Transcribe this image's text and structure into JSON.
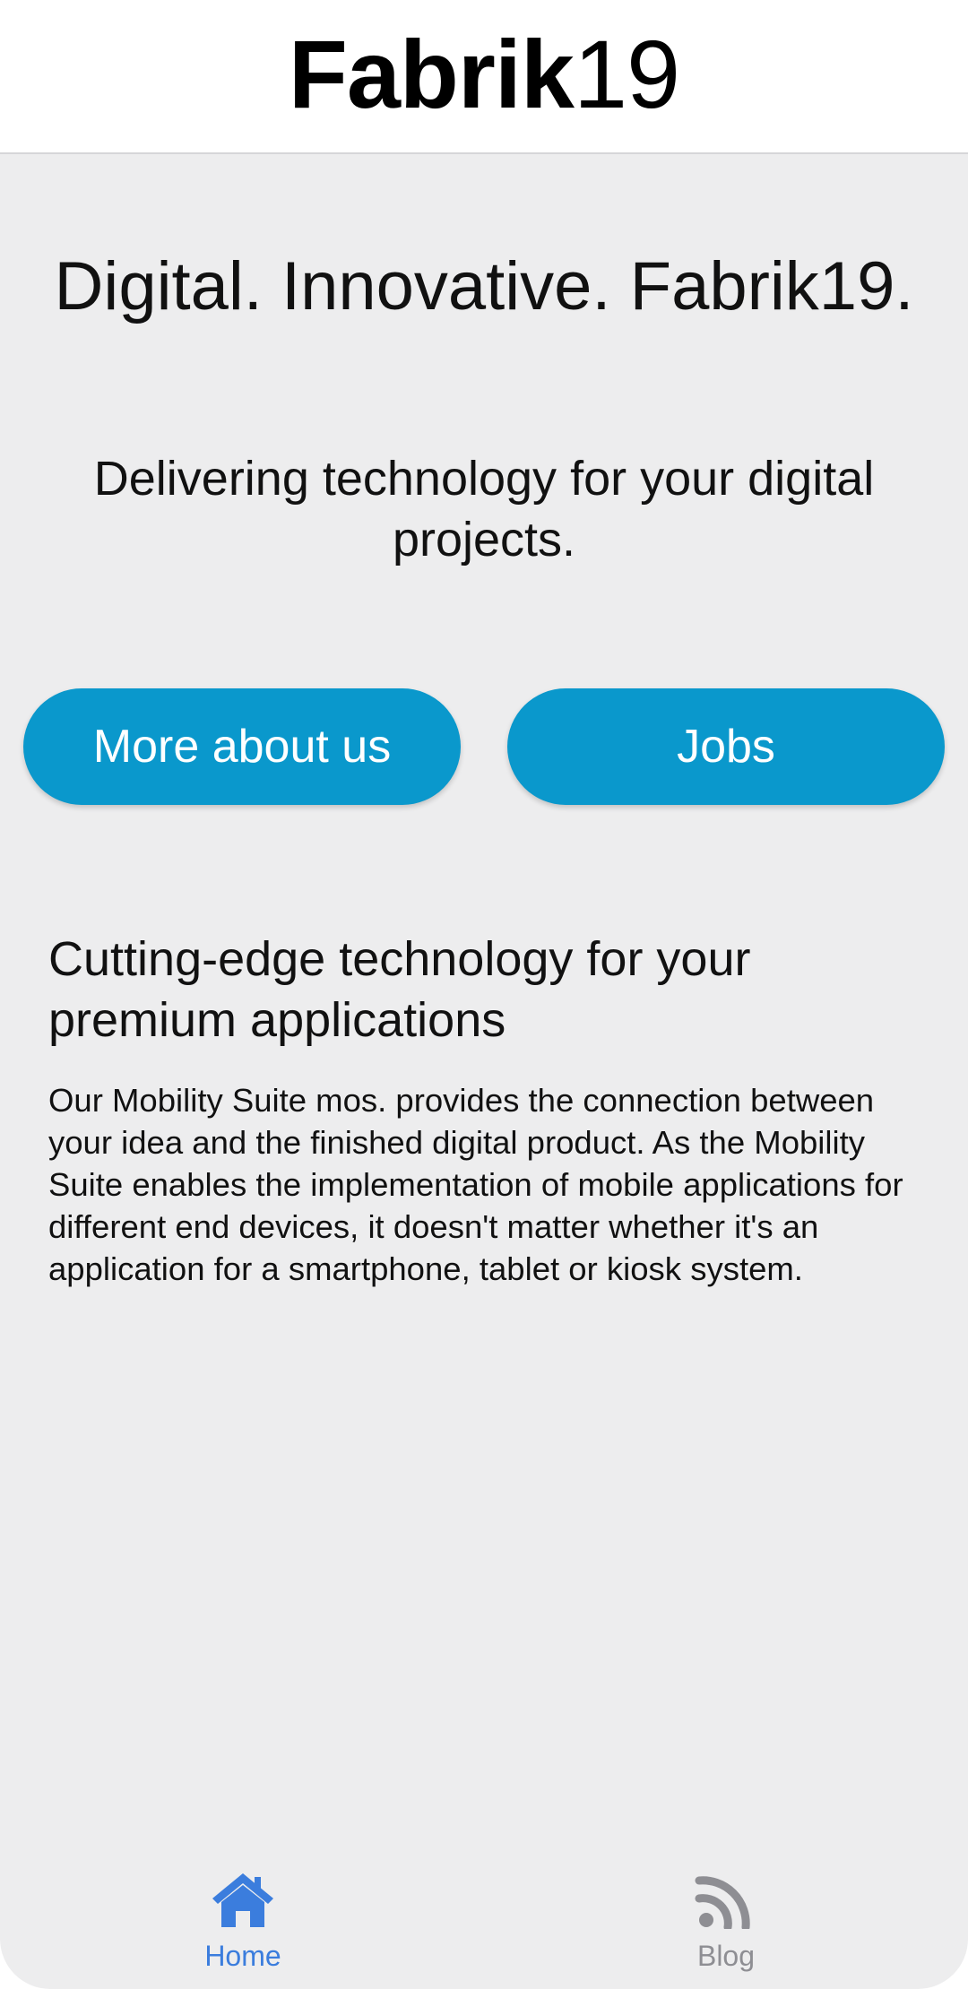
{
  "header": {
    "brand_bold": "Fabrik",
    "brand_regular": "19"
  },
  "hero": {
    "headline": "Digital. Innovative. Fabrik19.",
    "subline": "Delivering technology for your digital projects."
  },
  "buttons": {
    "more_label": "More about us",
    "jobs_label": "Jobs"
  },
  "section": {
    "title": "Cutting-edge technology for your premium applications",
    "body": "Our Mobility Suite mos. provides the connection between your idea and the finished digital product. As the Mobility Suite enables the implementation of mobile applications for different end devices, it doesn't matter whether it's an application for a smartphone, tablet or kiosk system."
  },
  "tabbar": {
    "items": [
      {
        "label": "Home",
        "icon": "home-icon",
        "active": true
      },
      {
        "label": "Blog",
        "icon": "rss-icon",
        "active": false
      }
    ]
  },
  "colors": {
    "accent": "#0a98cc",
    "active_tab": "#3b7ddd",
    "inactive_tab": "#8e8e93",
    "background": "#ededee"
  }
}
